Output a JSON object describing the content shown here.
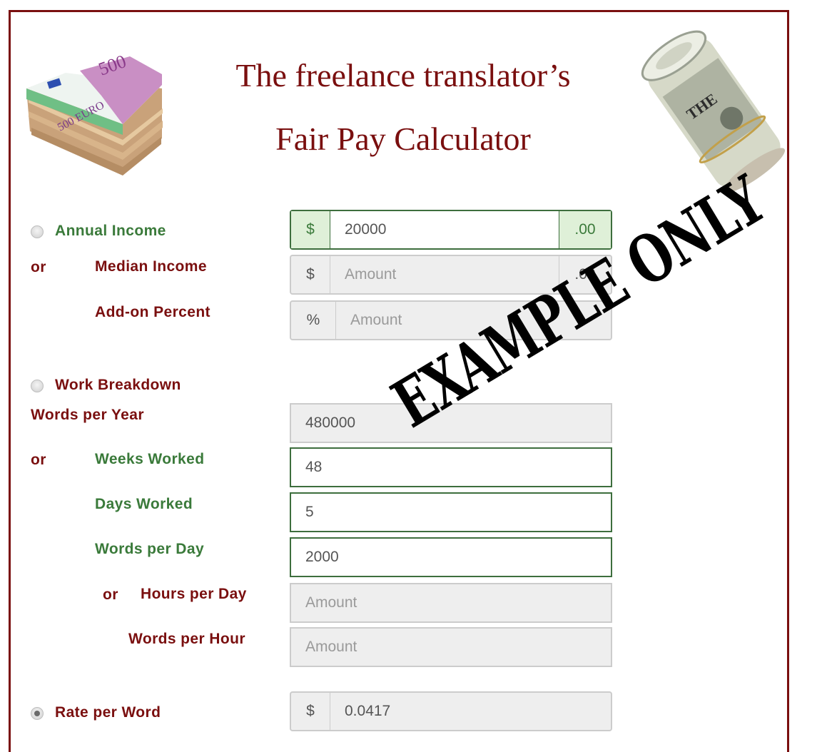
{
  "header": {
    "title_line1": "The freelance translator’s",
    "title_line2": "Fair Pay Calculator",
    "left_image": "euro-banknote-stack",
    "right_image": "rolled-dollar-bills"
  },
  "watermark": "EXAMPLE ONLY",
  "colors": {
    "brand_red": "#7a0f0f",
    "active_green": "#3a7a3a",
    "addon_green_bg": "#dff0d8",
    "disabled_bg": "#eeeeee"
  },
  "income": {
    "radio_label": "Annual Income",
    "radio_checked": false,
    "annual": {
      "prefix": "$",
      "value": "20000",
      "suffix": ".00"
    },
    "or_label": "or",
    "median_label": "Median Income",
    "median": {
      "prefix": "$",
      "placeholder": "Amount",
      "suffix": ".00"
    },
    "addon_label": "Add-on Percent",
    "addon": {
      "prefix": "%",
      "placeholder": "Amount"
    }
  },
  "work": {
    "radio_label": "Work Breakdown",
    "radio_checked": false,
    "words_per_year_label": "Words per Year",
    "words_per_year_value": "480000",
    "or_label": "or",
    "weeks_label": "Weeks Worked",
    "weeks_value": "48",
    "days_label": "Days Worked",
    "days_value": "5",
    "words_per_day_label": "Words per Day",
    "words_per_day_value": "2000",
    "or2_label": "or",
    "hours_label": "Hours per Day",
    "hours_placeholder": "Amount",
    "words_per_hour_label": "Words per Hour",
    "words_per_hour_placeholder": "Amount"
  },
  "rate": {
    "radio_label": "Rate per Word",
    "radio_checked": true,
    "prefix": "$",
    "value": "0.0417"
  }
}
